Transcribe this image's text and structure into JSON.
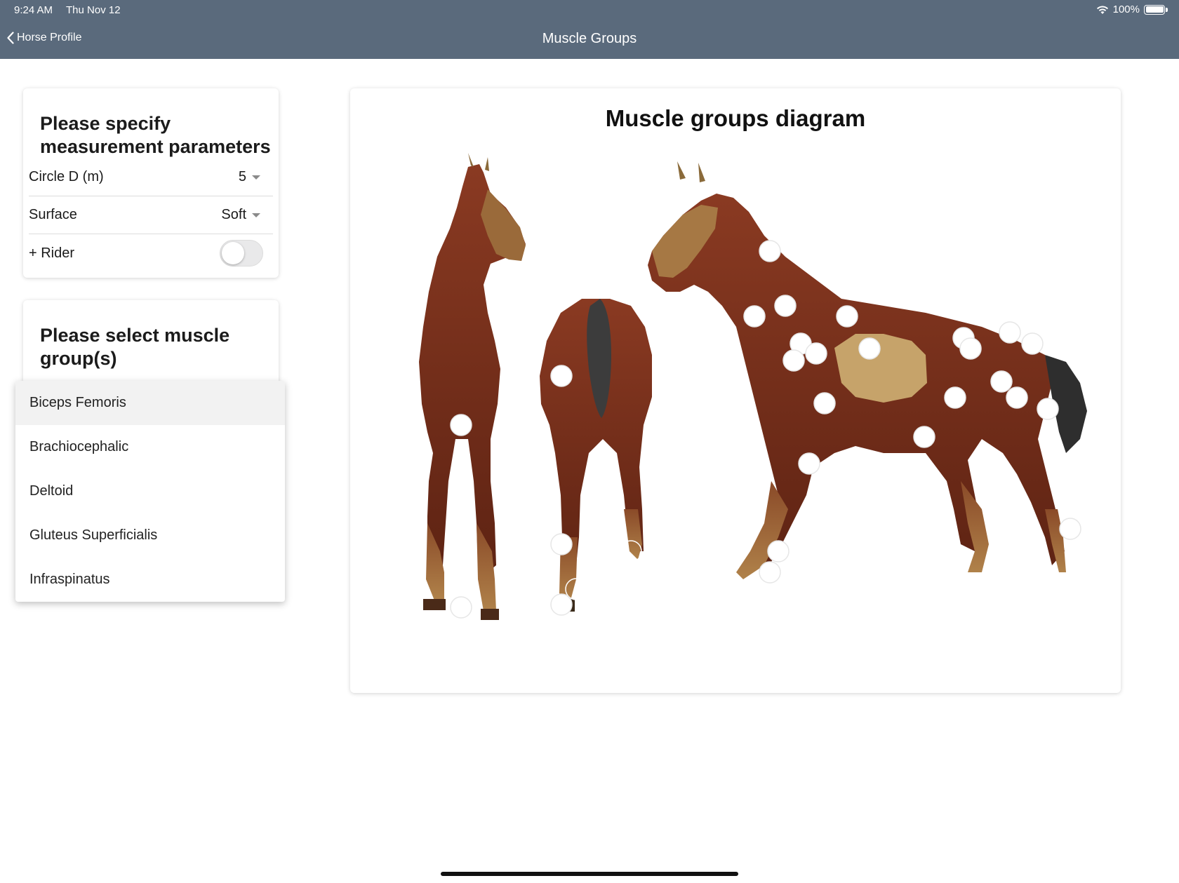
{
  "status_bar": {
    "time": "9:24 AM",
    "date": "Thu Nov 12",
    "battery": "100%"
  },
  "nav": {
    "back_label": "Horse Profile",
    "title": "Muscle Groups"
  },
  "params": {
    "heading": "Please specify measurement parameters",
    "circle_label": "Circle D (m)",
    "circle_value": "5",
    "surface_label": "Surface",
    "surface_value": "Soft",
    "rider_label": "+ Rider",
    "rider_on": false
  },
  "muscle_select": {
    "heading": "Please select muscle group(s)",
    "options": [
      "Biceps Femoris",
      "Brachiocephalic",
      "Deltoid",
      "Gluteus Superficialis",
      "Infraspinatus"
    ]
  },
  "diagram": {
    "title": "Muscle groups diagram"
  }
}
